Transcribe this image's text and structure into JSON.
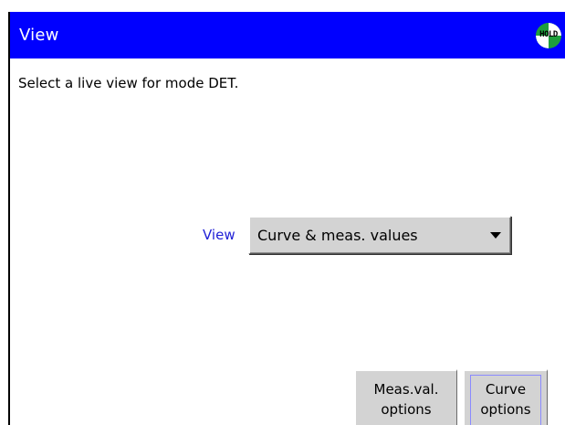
{
  "title_bar": {
    "title": "View",
    "hold_badge": "HOLD",
    "hold_icon_colors": {
      "green": "#1e9e3c",
      "white": "#ffffff"
    },
    "background_color": "#0000ff"
  },
  "instruction": "Select a live view for mode DET.",
  "view_field": {
    "label": "View",
    "label_color": "#1f1fd6",
    "selected_value": "Curve & meas. values",
    "caret_icon": "chevron-down-icon"
  },
  "buttons": {
    "meas_val_options": {
      "line1": "Meas.val.",
      "line2": "options"
    },
    "curve_options": {
      "line1": "Curve",
      "line2": "options"
    }
  }
}
